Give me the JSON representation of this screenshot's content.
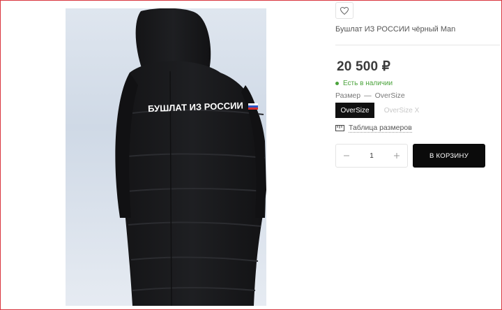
{
  "product": {
    "title": "Бушлат ИЗ РОССИИ чёрный Man",
    "price": "20 500 ₽",
    "stock": "Есть в наличии",
    "size_label": "Размер",
    "size_separator": "—",
    "size_selected": "OverSize",
    "sizes": [
      "OverSize",
      "OverSize X"
    ],
    "size_table_label": "Таблица размеров",
    "quantity": "1",
    "add_to_cart": "В КОРЗИНУ",
    "image_text": "БУШЛАТ ИЗ РОССИИ"
  },
  "icons": {
    "favorite": "heart-icon",
    "size_table": "ruler-icon",
    "minus": "minus-icon",
    "plus": "plus-icon"
  },
  "colors": {
    "accent": "#0b0b0b",
    "in_stock": "#4aa33b",
    "border_frame": "#d9363e"
  }
}
